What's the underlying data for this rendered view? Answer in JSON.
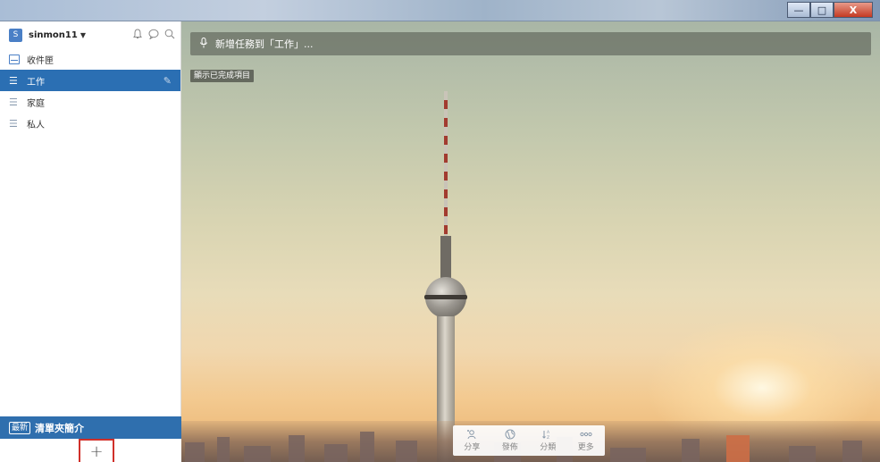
{
  "window": {
    "controls": {
      "minimize": "—",
      "maximize": "□",
      "close": "X"
    }
  },
  "sidebar": {
    "user": {
      "avatar_letter": "S",
      "name": "sinmon11",
      "caret": "▼"
    },
    "header_icons": [
      "bell-icon",
      "chat-icon",
      "search-icon"
    ],
    "items": [
      {
        "label": "收件匣",
        "icon": "inbox-icon",
        "active": false
      },
      {
        "label": "工作",
        "icon": "list-icon",
        "active": true
      },
      {
        "label": "家庭",
        "icon": "list-icon",
        "active": false
      },
      {
        "label": "私人",
        "icon": "list-icon",
        "active": false
      }
    ],
    "news": {
      "badge": "最新",
      "title": "清單夾簡介"
    },
    "add_label": "+"
  },
  "main": {
    "add_task_placeholder": "新增任務到「工作」...",
    "show_completed": "顯示已完成項目",
    "toolbar": [
      {
        "label": "分享",
        "icon": "share-icon"
      },
      {
        "label": "發佈",
        "icon": "globe-icon"
      },
      {
        "label": "分類",
        "icon": "sort-icon"
      },
      {
        "label": "更多",
        "icon": "more-icon"
      }
    ]
  },
  "colors": {
    "accent": "#2b6fb3",
    "highlight_border": "#d0302a"
  }
}
